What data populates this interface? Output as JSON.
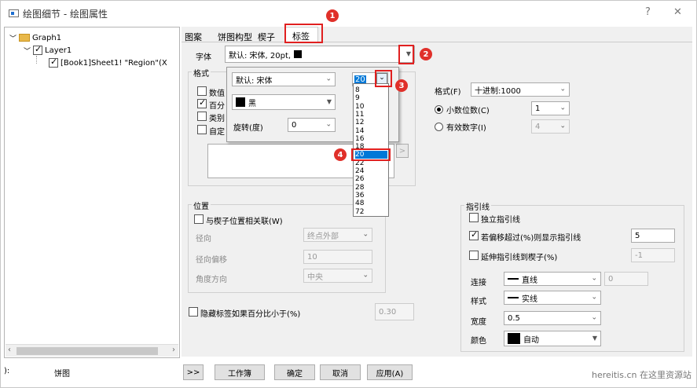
{
  "window": {
    "title": "绘图细节 - 绘图属性",
    "help": "?",
    "close": "✕"
  },
  "tree": {
    "graph": "Graph1",
    "layer": "Layer1",
    "plot": "[Book1]Sheet1! \"Region\"(X"
  },
  "footer": {
    "left_label": "):",
    "type_label": "饼图",
    "more": ">>",
    "workbook": "工作簿",
    "ok": "确定",
    "cancel": "取消",
    "apply": "应用(A)"
  },
  "tabs": [
    "图案",
    "饼图构型",
    "楔子",
    "标签"
  ],
  "font": {
    "label": "字体",
    "value": "默认: 宋体, 20pt,"
  },
  "format_group": "格式",
  "checkboxes_left": [
    "数值",
    "百分",
    "类别",
    "自定"
  ],
  "checkbox_left_states": [
    false,
    true,
    false,
    false
  ],
  "popup": {
    "font_name": "默认: 宋体",
    "size_value": "20",
    "color": "黑",
    "rotate_label": "旋转(度)",
    "rotate_value": "0"
  },
  "size_options": [
    "8",
    "9",
    "10",
    "11",
    "12",
    "14",
    "16",
    "18",
    "20",
    "22",
    "24",
    "26",
    "28",
    "36",
    "48",
    "72"
  ],
  "selected_size": "20",
  "format_right": {
    "format_label": "格式(F)",
    "format_value": "十进制:1000",
    "decimals_label": "小数位数(C)",
    "decimals_value": "1",
    "sigfig_label": "有效数字(I)",
    "sigfig_value": "4"
  },
  "position": {
    "title": "位置",
    "link_label": "与楔子位置相关联(W)",
    "radial_label": "径向",
    "radial_value": "终点外部",
    "offset_label": "径向偏移",
    "offset_value": "10",
    "angle_label": "角度方向",
    "angle_value": "中央"
  },
  "hide": {
    "label": "隐藏标签如果百分比小于(%)",
    "value": "0.30"
  },
  "leader": {
    "title": "指引线",
    "independent": "独立指引线",
    "show_if": "若偏移超过(%)则显示指引线",
    "show_if_value": "5",
    "extend": "延伸指引线到楔子(%)",
    "extend_value": "-1",
    "connect_label": "连接",
    "connect_value": "直线",
    "connect_num": "0",
    "style_label": "样式",
    "style_value": "实线",
    "width_label": "宽度",
    "width_value": "0.5",
    "color_label": "颜色",
    "color_value": "自动"
  },
  "badges": [
    "1",
    "2",
    "3",
    "4"
  ],
  "watermark": "hereitis.cn 在这里资源站",
  "accent": "#e02020"
}
